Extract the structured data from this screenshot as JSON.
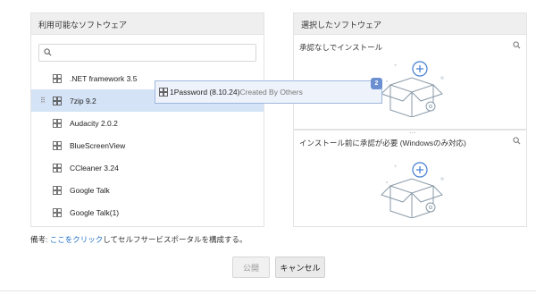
{
  "available_panel": {
    "title": "利用可能なソフトウェア",
    "search_placeholder": "",
    "items": [
      {
        "label": ".NET framework 3.5",
        "selected": false
      },
      {
        "label": "7zip 9.2",
        "selected": true
      },
      {
        "label": "Audacity 2.0.2",
        "selected": false
      },
      {
        "label": "BlueScreenView",
        "selected": false
      },
      {
        "label": "CCleaner 3.24",
        "selected": false
      },
      {
        "label": "Google Talk",
        "selected": false
      },
      {
        "label": "Google Talk(1)",
        "selected": false
      }
    ]
  },
  "selected_panel": {
    "title": "選択したソフトウェア",
    "sections": [
      {
        "title": "承認なしでインストール"
      },
      {
        "title": "インストール前に承認が必要 (Windowsのみ対応)"
      }
    ],
    "divider": "…"
  },
  "drag_ghost": {
    "name": "1Password (8.10.24)",
    "created_by": "Created By Others",
    "count": "2"
  },
  "note": {
    "prefix": "備考: ",
    "link": "ここをクリック",
    "suffix": "してセルフサービスポータルを構成する。"
  },
  "buttons": {
    "publish": "公開",
    "cancel": "キャンセル"
  },
  "colors": {
    "accent": "#1f6fc5",
    "selected_row": "#d5e3f7",
    "badge": "#6b8fd1"
  }
}
